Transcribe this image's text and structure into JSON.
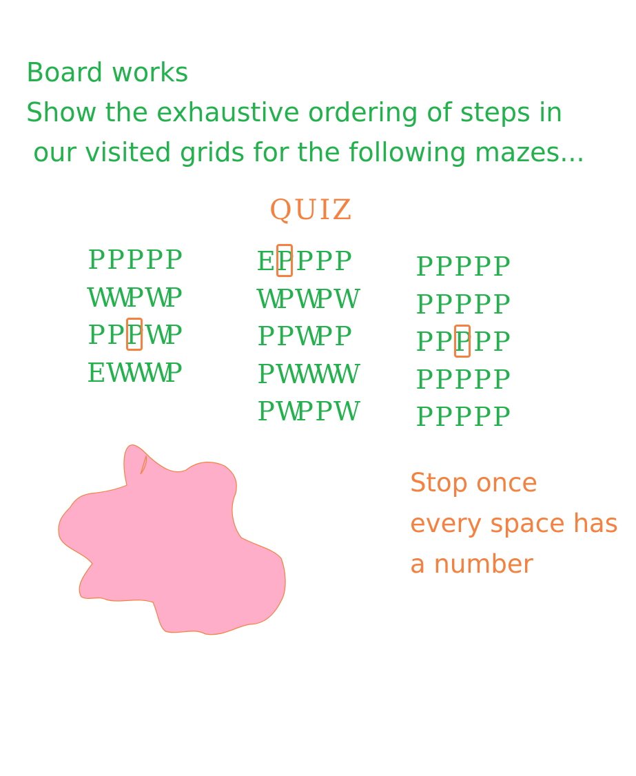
{
  "heading": {
    "line1": "Board works",
    "line2": "Show the exhaustive ordering of steps in",
    "line3": "our visited grids for the following mazes..."
  },
  "quiz_label": "QUIZ",
  "mazes": [
    {
      "rows": [
        "PPPPP",
        "WWPWP",
        "PPPWP",
        "EWWWP"
      ],
      "start": [
        2,
        2
      ]
    },
    {
      "rows": [
        "EPPPP",
        "WPWPW",
        "PPWPP",
        "PWWWW",
        "PWPPW"
      ],
      "start": [
        0,
        1
      ]
    },
    {
      "rows": [
        "PPPPP",
        "PPPPP",
        "PPPPP",
        "PPPPP",
        "PPPPP"
      ],
      "start": [
        2,
        2
      ]
    }
  ],
  "note": {
    "line1": "Stop once",
    "line2": "every space has",
    "line3": "a number"
  },
  "colors": {
    "green": "#22b14c",
    "orange": "#f4813f",
    "blob": "#ffaec9"
  }
}
